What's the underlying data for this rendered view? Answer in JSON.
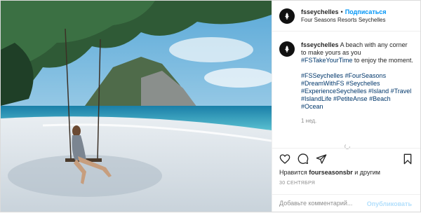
{
  "post": {
    "username": "fsseychelles",
    "follow_label": "Подписаться",
    "separator": "•",
    "location": "Four Seasons Resorts Seychelles",
    "caption": {
      "username": "fsseychelles",
      "text_1": "A beach with any corner to make yours as you",
      "hashtag_1": "#FSTakeYourTime",
      "text_2": "to enjoy the moment.",
      "tags_line_1": "#FSSeychelles #FourSeasons",
      "tags_line_2": "#DreamWithFS #Seychelles",
      "tags_line_3": "#ExperienceSeychelles #Island #Travel",
      "tags_line_4": "#IslandLife #PetiteAnse #Beach",
      "tags_line_5": "#Ocean"
    },
    "time_ago": "1 нед.",
    "likes": {
      "prefix": "Нравится",
      "liker": "fourseasonsbr",
      "suffix": "и другим"
    },
    "date": "30 СЕНТЯБРЯ",
    "comment": {
      "placeholder": "Добавьте комментарий...",
      "publish_label": "Опубликовать"
    }
  },
  "icons": {
    "avatar": "four-seasons-tree-logo",
    "like": "heart-icon",
    "comment": "comment-bubble-icon",
    "share": "paper-plane-icon",
    "save": "bookmark-icon"
  },
  "colors": {
    "link_blue": "#0095f6",
    "hashtag": "#00376b",
    "muted": "#8e8e8e",
    "publish_disabled": "#b2dffc"
  }
}
